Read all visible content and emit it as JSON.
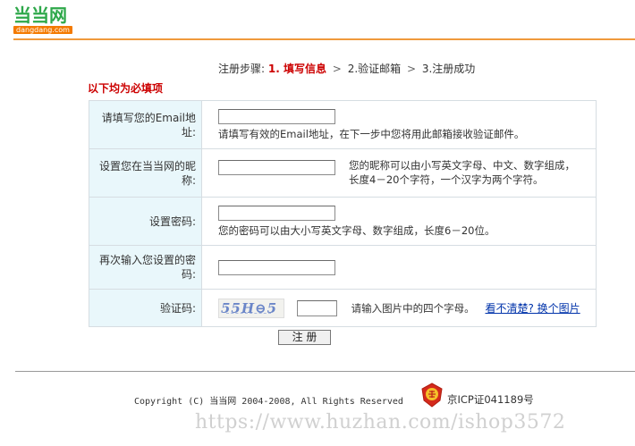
{
  "logo": {
    "name_cn": "当当网",
    "domain": "dangdang.com"
  },
  "steps": {
    "prefix": "注册步骤:",
    "step1": "1. 填写信息",
    "arrow1": ">",
    "step2": "2.验证邮箱",
    "arrow2": ">",
    "step3": "3.注册成功"
  },
  "required_note": "以下均为必填项",
  "form": {
    "email": {
      "label": "请填写您的Email地址:",
      "value": "",
      "hint": "请填写有效的Email地址，在下一步中您将用此邮箱接收验证邮件。"
    },
    "nickname": {
      "label": "设置您在当当网的昵称:",
      "value": "",
      "hint_line1": "您的昵称可以由小写英文字母、中文、数字组成，",
      "hint_line2": "长度4－20个字符，一个汉字为两个字符。"
    },
    "password": {
      "label": "设置密码:",
      "value": "",
      "hint": "您的密码可以由大小写英文字母、数字组成，长度6－20位。"
    },
    "password_confirm": {
      "label": "再次输入您设置的密码:",
      "value": ""
    },
    "captcha": {
      "label": "验证码:",
      "image_text": "55H⊖5",
      "value": "",
      "hint": "请输入图片中的四个字母。",
      "refresh_link": "看不清楚? 换个图片"
    }
  },
  "submit_label": "注 册",
  "footer": {
    "copyright": "Copyright (C) 当当网 2004-2008, All Rights Reserved",
    "icp": "京ICP证041189号"
  },
  "watermark": "https://www.huzhan.com/ishop3572",
  "colors": {
    "brand_green": "#2ea84a",
    "brand_orange": "#f47a00",
    "accent_red": "#cc0000",
    "label_bg": "#e9f7fb",
    "link_blue": "#0033aa"
  }
}
